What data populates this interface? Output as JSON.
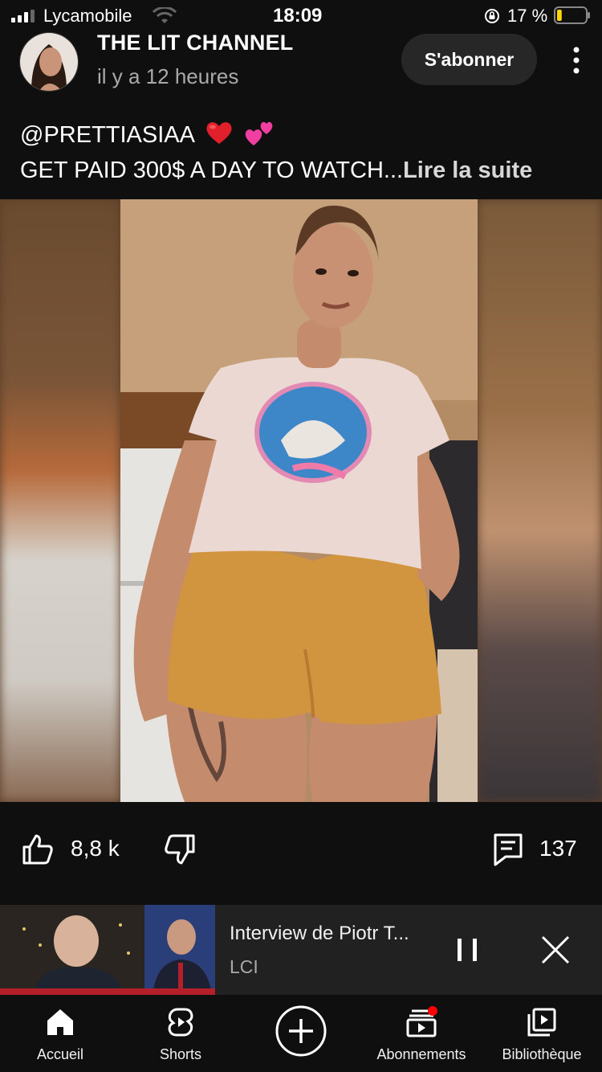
{
  "status_bar": {
    "carrier": "Lycamobile",
    "time": "18:09",
    "battery_percent": "17 %",
    "battery_level": 0.17,
    "battery_color": "#ffd60a"
  },
  "channel": {
    "name": "THE LIT CHANNEL",
    "posted": "il y a 12 heures",
    "subscribe_label": "S'abonner"
  },
  "description": {
    "line1": "@PRETTIASIAA",
    "line1_emojis": [
      "red-heart-emoji",
      "two-hearts-emoji"
    ],
    "line2": "GET PAID 300$ A DAY TO WATCH...",
    "read_more": "Lire la suite"
  },
  "actions": {
    "likes": "8,8 k",
    "comments": "137"
  },
  "mini_player": {
    "title": "Interview de Piotr T...",
    "channel": "LCI"
  },
  "nav": {
    "items": [
      {
        "label": "Accueil",
        "icon": "home-icon"
      },
      {
        "label": "Shorts",
        "icon": "shorts-icon"
      },
      {
        "label": "",
        "icon": "create-icon"
      },
      {
        "label": "Abonnements",
        "icon": "subscriptions-icon"
      },
      {
        "label": "Bibliothèque",
        "icon": "library-icon"
      }
    ],
    "notification_color": "#ff0000"
  }
}
